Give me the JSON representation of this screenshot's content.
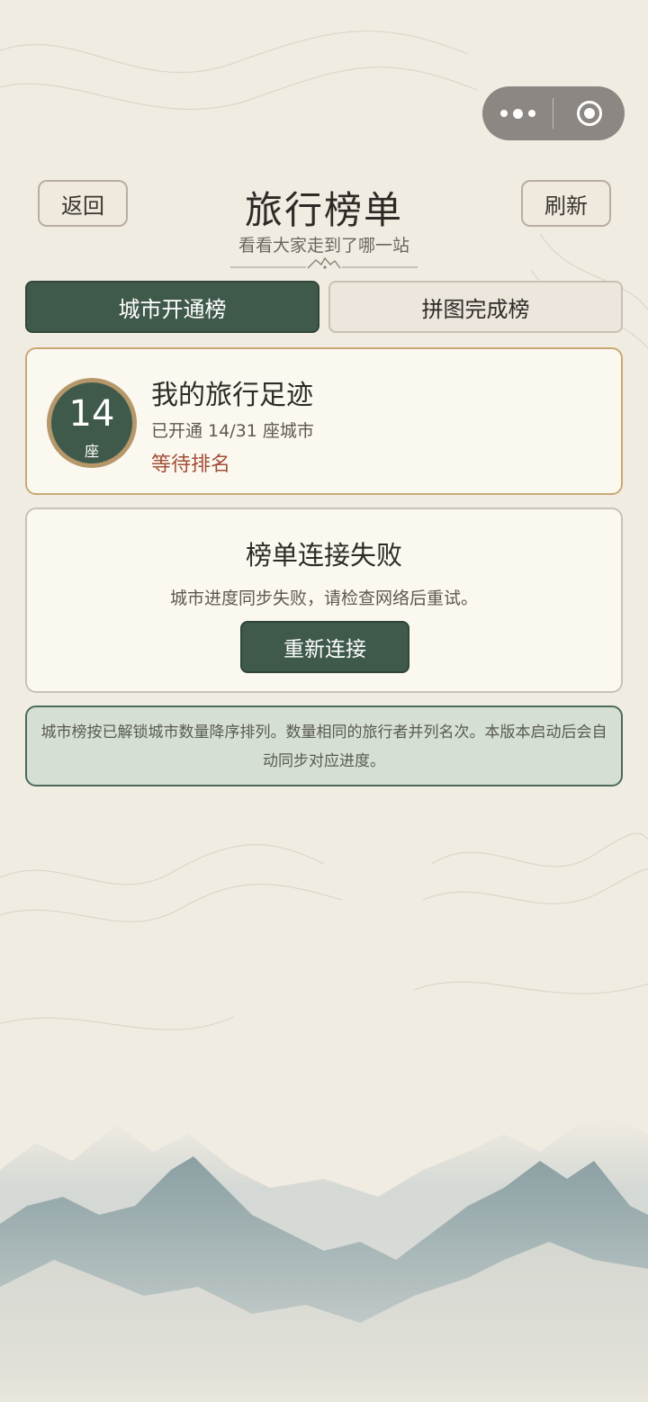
{
  "header": {
    "back_label": "返回",
    "refresh_label": "刷新",
    "title": "旅行榜单",
    "subtitle": "看看大家走到了哪一站"
  },
  "tabs": [
    {
      "label": "城市开通榜",
      "active": true
    },
    {
      "label": "拼图完成榜",
      "active": false
    }
  ],
  "my_card": {
    "count": "14",
    "count_unit": "座",
    "title": "我的旅行足迹",
    "detail": "已开通 14/31 座城市",
    "status": "等待排名"
  },
  "error_card": {
    "title": "榜单连接失败",
    "message": "城市进度同步失败，请检查网络后重试。",
    "retry_label": "重新连接"
  },
  "note": {
    "text": "城市榜按已解锁城市数量降序排列。数量相同的旅行者并列名次。本版本启动后会自动同步对应进度。"
  },
  "colors": {
    "accent": "#3f5a4b",
    "background": "#f1ece2",
    "status_red": "#a24e37",
    "gold": "#b5976a"
  },
  "icons": {
    "more": "more-dots-icon",
    "close": "miniprogram-close-icon",
    "ornament": "mountain-ornament-icon"
  }
}
